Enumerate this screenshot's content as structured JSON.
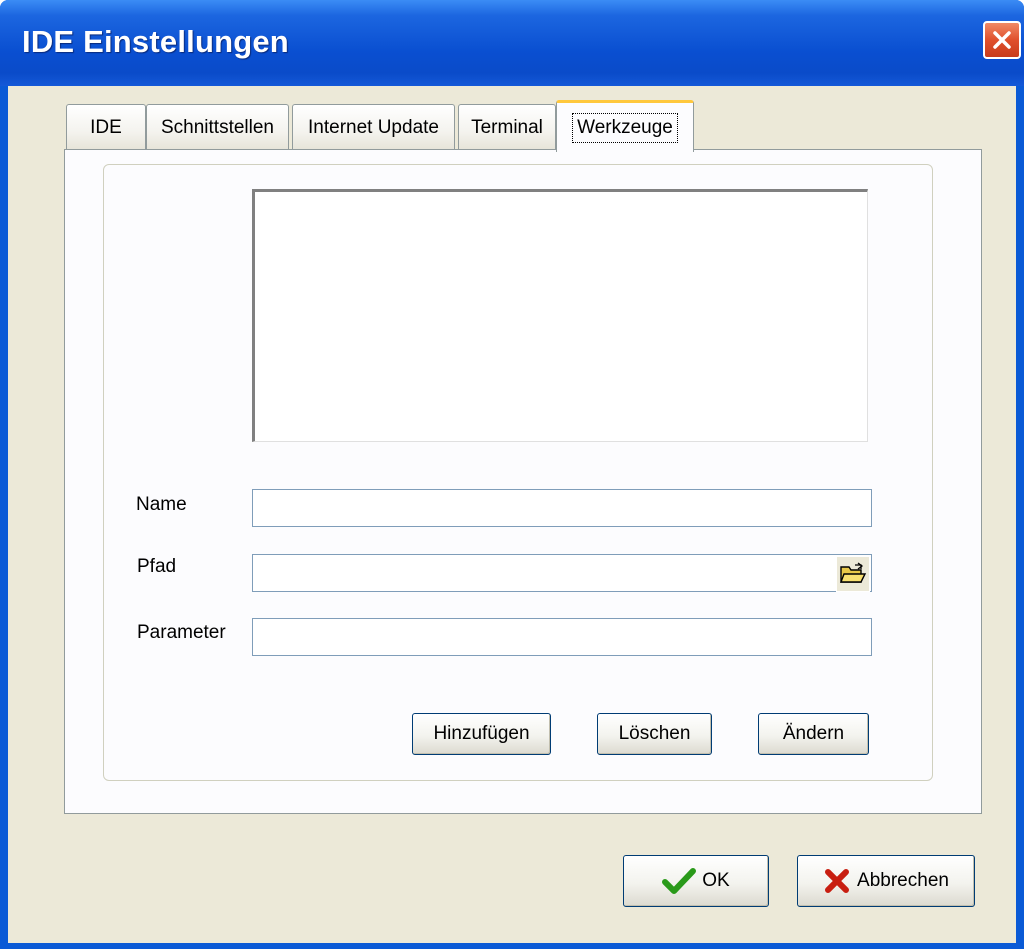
{
  "window": {
    "title": "IDE Einstellungen"
  },
  "tabs": [
    {
      "label": "IDE",
      "active": false
    },
    {
      "label": "Schnittstellen",
      "active": false
    },
    {
      "label": "Internet Update",
      "active": false
    },
    {
      "label": "Terminal",
      "active": false
    },
    {
      "label": "Werkzeuge",
      "active": true
    }
  ],
  "tools": {
    "list_items": [],
    "name_label": "Name",
    "name_value": "",
    "path_label": "Pfad",
    "path_value": "",
    "parameter_label": "Parameter",
    "parameter_value": "",
    "add_label": "Hinzufügen",
    "delete_label": "Löschen",
    "change_label": "Ändern"
  },
  "footer": {
    "ok_label": "OK",
    "cancel_label": "Abbrechen"
  },
  "colors": {
    "titlebar": "#0a4fd1",
    "dialog_bg": "#ece9d8",
    "active_tab_accent": "#ffc83c",
    "ok_check": "#2a9a1a",
    "cancel_x": "#c81e10"
  },
  "icons": {
    "close": "close-icon",
    "browse": "folder-open-icon",
    "ok": "checkmark-icon",
    "cancel": "x-icon"
  }
}
